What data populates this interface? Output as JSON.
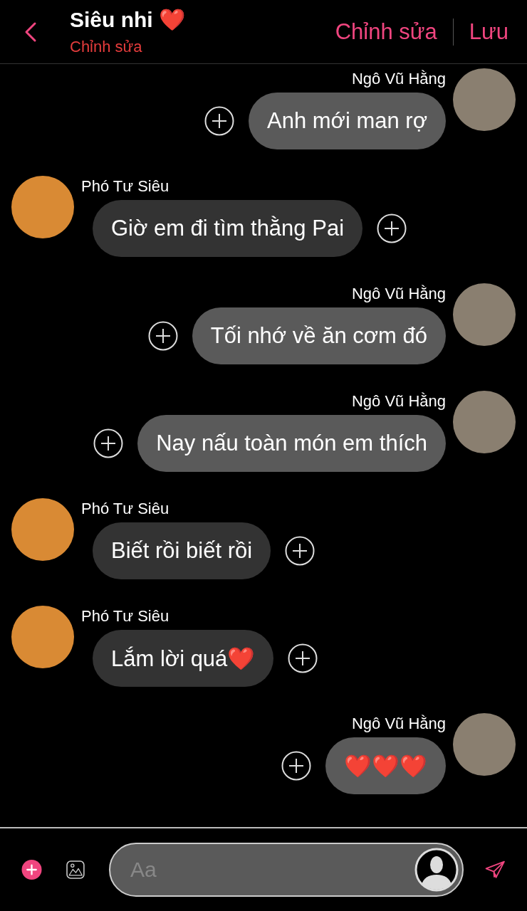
{
  "header": {
    "title": "Siêu nhi ❤️",
    "subtitle": "Chỉnh sửa",
    "actions": [
      "Chỉnh sửa",
      "Lưu"
    ]
  },
  "messages": [
    {
      "kind": "me",
      "sender": "Ngô Vũ Hằng",
      "text": "Anh mới man rợ"
    },
    {
      "kind": "other",
      "sender": "Phó Tư Siêu",
      "text": "Giờ em đi tìm thằng Pai"
    },
    {
      "kind": "me",
      "sender": "Ngô Vũ Hằng",
      "text": "Tối nhớ về ăn cơm đó"
    },
    {
      "kind": "me",
      "sender": "Ngô Vũ Hằng",
      "text": "Nay nấu toàn món em thích"
    },
    {
      "kind": "other",
      "sender": "Phó Tư Siêu",
      "text": "Biết rồi biết rồi"
    },
    {
      "kind": "other",
      "sender": "Phó Tư Siêu",
      "text": "Lắm lời quá❤️"
    },
    {
      "kind": "me",
      "sender": "Ngô Vũ Hằng",
      "text": "❤️❤️❤️"
    }
  ],
  "composer": {
    "placeholder": "Aa"
  }
}
